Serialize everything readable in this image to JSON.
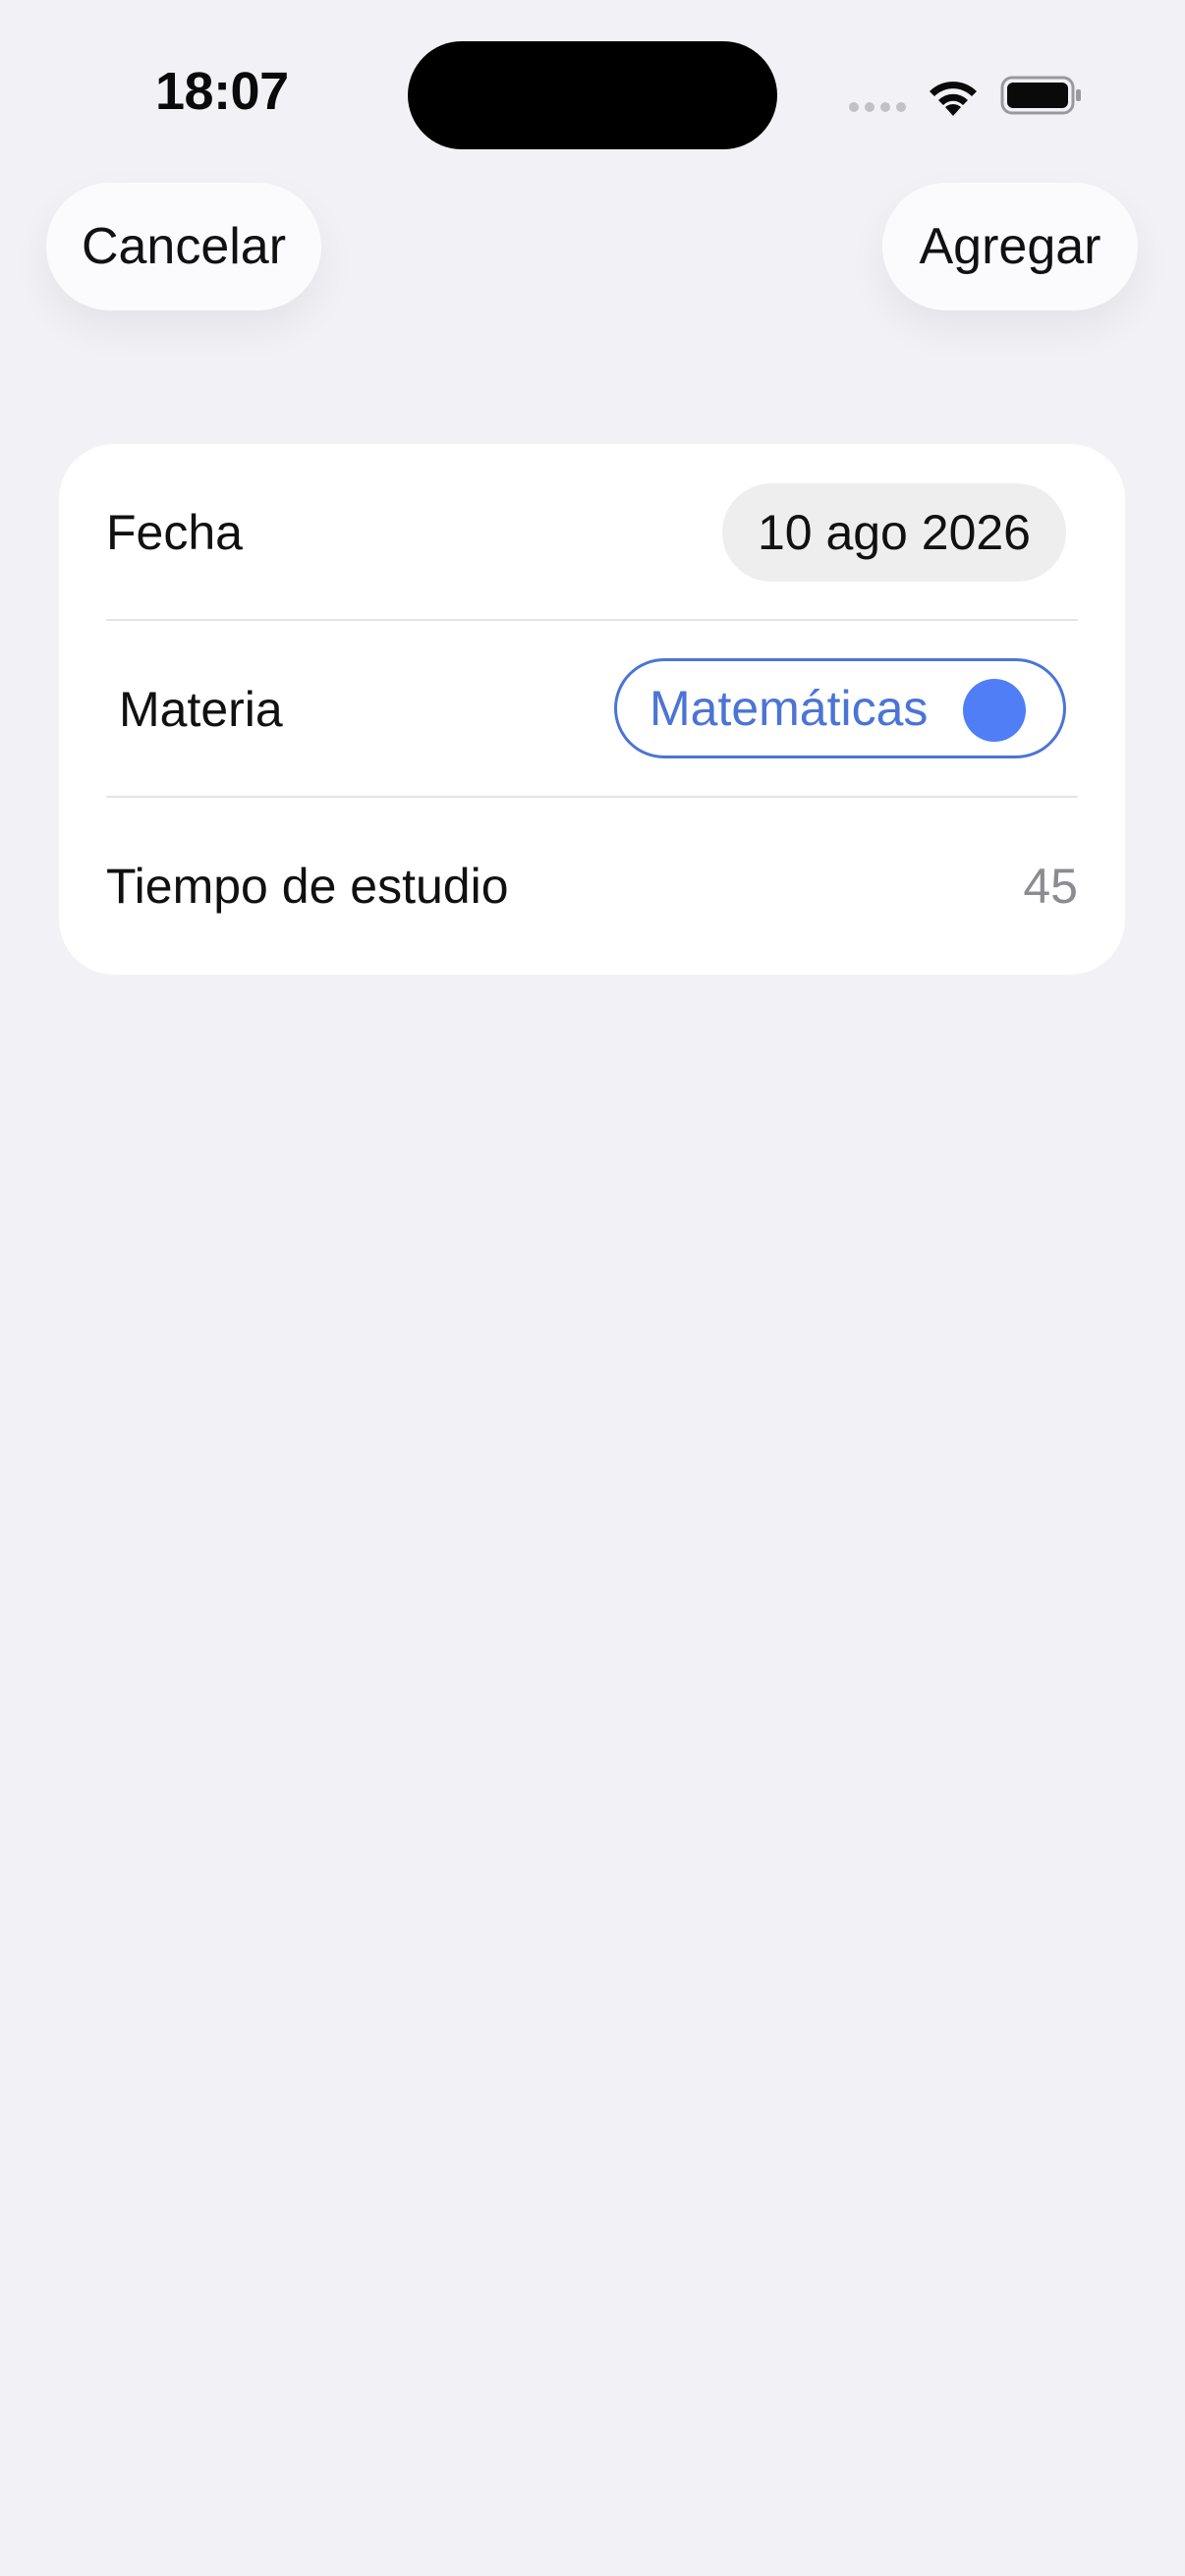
{
  "status_bar": {
    "time": "18:07",
    "signal_icon": "signal-dots-icon",
    "wifi_icon": "wifi-icon",
    "battery_icon": "battery-icon"
  },
  "nav": {
    "cancel_label": "Cancelar",
    "add_label": "Agregar"
  },
  "form": {
    "date": {
      "label": "Fecha",
      "value": "10 ago 2026"
    },
    "subject": {
      "label": "Materia",
      "value": "Matemáticas",
      "color": "#4f7ef7",
      "text_color": "#4b74d6"
    },
    "study_time": {
      "label": "Tiempo de estudio",
      "value": "45"
    }
  },
  "colors": {
    "background": "#f1f1f6",
    "card": "#ffffff",
    "accent": "#4b74d6",
    "secondary_text": "#8c8c90"
  }
}
